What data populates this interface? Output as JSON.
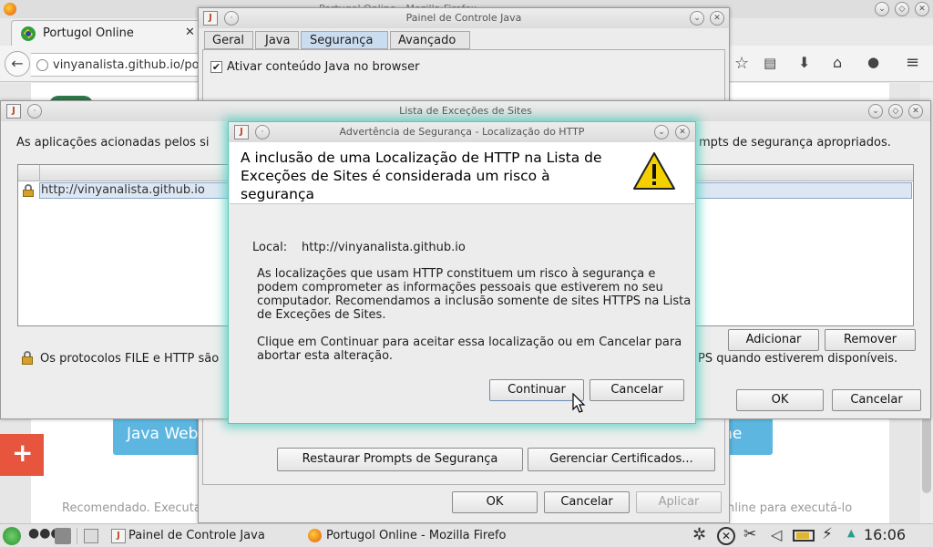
{
  "firefox": {
    "window_title": "Portugol Online - Mozilla Firefox",
    "tab_title": "Portugol Online",
    "url": "vinyanalista.github.io/por",
    "page_btn_left": "Java Web",
    "page_btn_right": "ffline",
    "page_footer_left": "Recomendado. Executa",
    "page_footer_right": "online para executá-lo",
    "plus_label": "+"
  },
  "java_panel": {
    "title": "Painel de Controle Java",
    "tabs": [
      "Geral",
      "Java",
      "Segurança",
      "Avançado"
    ],
    "enable_checkbox_label": "Ativar conteúdo Java no browser",
    "restore_button": "Restaurar Prompts de Segurança",
    "certs_button": "Gerenciar Certificados...",
    "ok_button": "OK",
    "cancel_button": "Cancelar",
    "apply_button": "Aplicar"
  },
  "exceptions": {
    "title": "Lista de Exceções de Sites",
    "intro_left": "As aplicações acionadas pelos si",
    "intro_right": "mpts de segurança apropriados.",
    "list_item": "http://vinyanalista.github.io",
    "add_button": "Adicionar",
    "remove_button": "Remover",
    "note_left": "Os protocolos FILE e HTTP são",
    "note_right": "PS quando estiverem disponíveis.",
    "ok_button": "OK",
    "cancel_button": "Cancelar"
  },
  "warning": {
    "title": "Advertência de Segurança - Localização do HTTP",
    "heading": "A inclusão de uma Localização de HTTP na Lista de Exceções de Sites é considerada um risco à segurança",
    "local_label": "Local:",
    "local_value": "http://vinyanalista.github.io",
    "body1": "As localizações que usam HTTP constituem um risco à segurança e podem comprometer as informações pessoais que estiverem no seu computador. Recomendamos a inclusão somente de sites HTTPS na Lista de Exceções de Sites.",
    "body2": "Clique em Continuar para aceitar essa localização ou em Cancelar para abortar esta alteração.",
    "continue_button": "Continuar",
    "cancel_button": "Cancelar"
  },
  "taskbar": {
    "task1": "Painel de Controle Java",
    "task2": "Portugol Online - Mozilla Firefo",
    "clock": "16:06"
  }
}
